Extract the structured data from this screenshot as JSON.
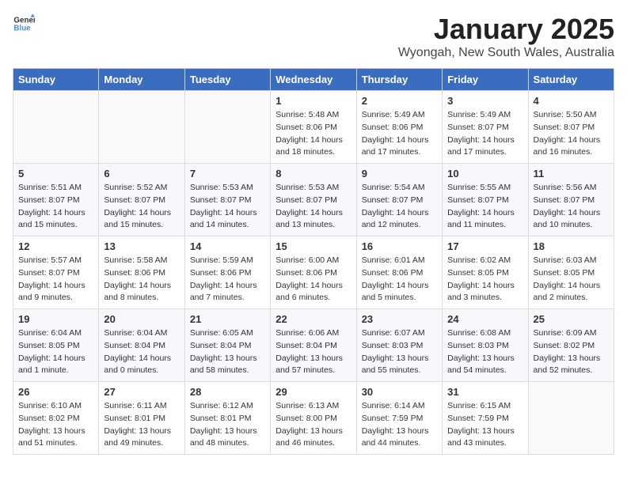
{
  "header": {
    "logo_general": "General",
    "logo_blue": "Blue",
    "month": "January 2025",
    "location": "Wyongah, New South Wales, Australia"
  },
  "weekdays": [
    "Sunday",
    "Monday",
    "Tuesday",
    "Wednesday",
    "Thursday",
    "Friday",
    "Saturday"
  ],
  "weeks": [
    [
      {
        "day": "",
        "info": ""
      },
      {
        "day": "",
        "info": ""
      },
      {
        "day": "",
        "info": ""
      },
      {
        "day": "1",
        "info": "Sunrise: 5:48 AM\nSunset: 8:06 PM\nDaylight: 14 hours\nand 18 minutes."
      },
      {
        "day": "2",
        "info": "Sunrise: 5:49 AM\nSunset: 8:06 PM\nDaylight: 14 hours\nand 17 minutes."
      },
      {
        "day": "3",
        "info": "Sunrise: 5:49 AM\nSunset: 8:07 PM\nDaylight: 14 hours\nand 17 minutes."
      },
      {
        "day": "4",
        "info": "Sunrise: 5:50 AM\nSunset: 8:07 PM\nDaylight: 14 hours\nand 16 minutes."
      }
    ],
    [
      {
        "day": "5",
        "info": "Sunrise: 5:51 AM\nSunset: 8:07 PM\nDaylight: 14 hours\nand 15 minutes."
      },
      {
        "day": "6",
        "info": "Sunrise: 5:52 AM\nSunset: 8:07 PM\nDaylight: 14 hours\nand 15 minutes."
      },
      {
        "day": "7",
        "info": "Sunrise: 5:53 AM\nSunset: 8:07 PM\nDaylight: 14 hours\nand 14 minutes."
      },
      {
        "day": "8",
        "info": "Sunrise: 5:53 AM\nSunset: 8:07 PM\nDaylight: 14 hours\nand 13 minutes."
      },
      {
        "day": "9",
        "info": "Sunrise: 5:54 AM\nSunset: 8:07 PM\nDaylight: 14 hours\nand 12 minutes."
      },
      {
        "day": "10",
        "info": "Sunrise: 5:55 AM\nSunset: 8:07 PM\nDaylight: 14 hours\nand 11 minutes."
      },
      {
        "day": "11",
        "info": "Sunrise: 5:56 AM\nSunset: 8:07 PM\nDaylight: 14 hours\nand 10 minutes."
      }
    ],
    [
      {
        "day": "12",
        "info": "Sunrise: 5:57 AM\nSunset: 8:07 PM\nDaylight: 14 hours\nand 9 minutes."
      },
      {
        "day": "13",
        "info": "Sunrise: 5:58 AM\nSunset: 8:06 PM\nDaylight: 14 hours\nand 8 minutes."
      },
      {
        "day": "14",
        "info": "Sunrise: 5:59 AM\nSunset: 8:06 PM\nDaylight: 14 hours\nand 7 minutes."
      },
      {
        "day": "15",
        "info": "Sunrise: 6:00 AM\nSunset: 8:06 PM\nDaylight: 14 hours\nand 6 minutes."
      },
      {
        "day": "16",
        "info": "Sunrise: 6:01 AM\nSunset: 8:06 PM\nDaylight: 14 hours\nand 5 minutes."
      },
      {
        "day": "17",
        "info": "Sunrise: 6:02 AM\nSunset: 8:05 PM\nDaylight: 14 hours\nand 3 minutes."
      },
      {
        "day": "18",
        "info": "Sunrise: 6:03 AM\nSunset: 8:05 PM\nDaylight: 14 hours\nand 2 minutes."
      }
    ],
    [
      {
        "day": "19",
        "info": "Sunrise: 6:04 AM\nSunset: 8:05 PM\nDaylight: 14 hours\nand 1 minute."
      },
      {
        "day": "20",
        "info": "Sunrise: 6:04 AM\nSunset: 8:04 PM\nDaylight: 14 hours\nand 0 minutes."
      },
      {
        "day": "21",
        "info": "Sunrise: 6:05 AM\nSunset: 8:04 PM\nDaylight: 13 hours\nand 58 minutes."
      },
      {
        "day": "22",
        "info": "Sunrise: 6:06 AM\nSunset: 8:04 PM\nDaylight: 13 hours\nand 57 minutes."
      },
      {
        "day": "23",
        "info": "Sunrise: 6:07 AM\nSunset: 8:03 PM\nDaylight: 13 hours\nand 55 minutes."
      },
      {
        "day": "24",
        "info": "Sunrise: 6:08 AM\nSunset: 8:03 PM\nDaylight: 13 hours\nand 54 minutes."
      },
      {
        "day": "25",
        "info": "Sunrise: 6:09 AM\nSunset: 8:02 PM\nDaylight: 13 hours\nand 52 minutes."
      }
    ],
    [
      {
        "day": "26",
        "info": "Sunrise: 6:10 AM\nSunset: 8:02 PM\nDaylight: 13 hours\nand 51 minutes."
      },
      {
        "day": "27",
        "info": "Sunrise: 6:11 AM\nSunset: 8:01 PM\nDaylight: 13 hours\nand 49 minutes."
      },
      {
        "day": "28",
        "info": "Sunrise: 6:12 AM\nSunset: 8:01 PM\nDaylight: 13 hours\nand 48 minutes."
      },
      {
        "day": "29",
        "info": "Sunrise: 6:13 AM\nSunset: 8:00 PM\nDaylight: 13 hours\nand 46 minutes."
      },
      {
        "day": "30",
        "info": "Sunrise: 6:14 AM\nSunset: 7:59 PM\nDaylight: 13 hours\nand 44 minutes."
      },
      {
        "day": "31",
        "info": "Sunrise: 6:15 AM\nSunset: 7:59 PM\nDaylight: 13 hours\nand 43 minutes."
      },
      {
        "day": "",
        "info": ""
      }
    ]
  ]
}
